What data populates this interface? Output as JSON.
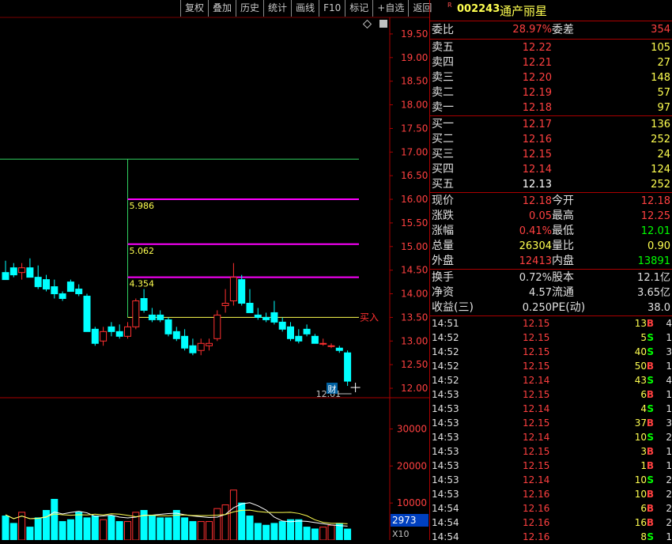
{
  "toolbar": {
    "items": [
      "复权",
      "叠加",
      "历史",
      "统计",
      "画线",
      "F10",
      "标记",
      "+自选",
      "返回"
    ]
  },
  "chart": {
    "price_axis": [
      "19.50",
      "19.00",
      "18.50",
      "18.00",
      "17.50",
      "17.00",
      "16.50",
      "16.00",
      "15.50",
      "15.00",
      "14.50",
      "14.00",
      "13.50",
      "13.00",
      "12.50",
      "12.00"
    ],
    "volume_axis": [
      "30000",
      "20000",
      "10000"
    ],
    "buy_label": "买入",
    "low_label": "12.01",
    "cai_label": "财",
    "fib_labels": [
      "5.986",
      "5.062",
      "4.354"
    ],
    "vol_readout": "2973",
    "vol_unit": "X10",
    "colors": {
      "up": "#ff3030",
      "down": "#00ffff",
      "fib": "#ff00ff",
      "grid": "#7a0000"
    }
  },
  "chart_data": {
    "type": "candlestick",
    "candles": [
      {
        "o": 14.45,
        "h": 14.7,
        "l": 14.3,
        "c": 14.3
      },
      {
        "o": 14.55,
        "h": 14.65,
        "l": 14.35,
        "c": 14.4
      },
      {
        "o": 14.45,
        "h": 14.65,
        "l": 14.3,
        "c": 14.55
      },
      {
        "o": 14.55,
        "h": 14.75,
        "l": 14.35,
        "c": 14.35
      },
      {
        "o": 14.35,
        "h": 14.6,
        "l": 14.1,
        "c": 14.15
      },
      {
        "o": 14.3,
        "h": 14.4,
        "l": 14.05,
        "c": 14.1
      },
      {
        "o": 14.15,
        "h": 14.3,
        "l": 13.9,
        "c": 14.0
      },
      {
        "o": 14.0,
        "h": 14.05,
        "l": 13.85,
        "c": 13.9
      },
      {
        "o": 14.25,
        "h": 14.3,
        "l": 14.05,
        "c": 14.05
      },
      {
        "o": 14.1,
        "h": 14.2,
        "l": 13.95,
        "c": 14.0
      },
      {
        "o": 13.95,
        "h": 14.0,
        "l": 13.2,
        "c": 13.2
      },
      {
        "o": 13.25,
        "h": 13.3,
        "l": 12.9,
        "c": 12.95
      },
      {
        "o": 13.0,
        "h": 13.3,
        "l": 12.9,
        "c": 13.2
      },
      {
        "o": 13.3,
        "h": 13.4,
        "l": 13.1,
        "c": 13.2
      },
      {
        "o": 13.2,
        "h": 13.35,
        "l": 13.05,
        "c": 13.1
      },
      {
        "o": 13.1,
        "h": 13.4,
        "l": 13.05,
        "c": 13.3
      },
      {
        "o": 13.3,
        "h": 13.9,
        "l": 13.25,
        "c": 13.85
      },
      {
        "o": 13.9,
        "h": 14.1,
        "l": 13.6,
        "c": 13.65
      },
      {
        "o": 13.55,
        "h": 13.7,
        "l": 13.4,
        "c": 13.45
      },
      {
        "o": 13.55,
        "h": 13.65,
        "l": 13.4,
        "c": 13.45
      },
      {
        "o": 13.45,
        "h": 13.5,
        "l": 13.1,
        "c": 13.15
      },
      {
        "o": 13.2,
        "h": 13.3,
        "l": 13.0,
        "c": 13.05
      },
      {
        "o": 13.1,
        "h": 13.25,
        "l": 12.8,
        "c": 12.85
      },
      {
        "o": 12.9,
        "h": 13.05,
        "l": 12.7,
        "c": 12.75
      },
      {
        "o": 12.8,
        "h": 13.05,
        "l": 12.7,
        "c": 12.95
      },
      {
        "o": 12.9,
        "h": 13.05,
        "l": 12.8,
        "c": 12.95
      },
      {
        "o": 13.05,
        "h": 13.65,
        "l": 13.0,
        "c": 13.55
      },
      {
        "o": 13.75,
        "h": 14.1,
        "l": 13.6,
        "c": 13.8
      },
      {
        "o": 13.85,
        "h": 14.65,
        "l": 13.75,
        "c": 14.35
      },
      {
        "o": 14.3,
        "h": 14.4,
        "l": 13.75,
        "c": 13.8
      },
      {
        "o": 13.8,
        "h": 14.1,
        "l": 13.6,
        "c": 13.6
      },
      {
        "o": 13.55,
        "h": 13.7,
        "l": 13.45,
        "c": 13.5
      },
      {
        "o": 13.5,
        "h": 13.6,
        "l": 13.4,
        "c": 13.45
      },
      {
        "o": 13.6,
        "h": 13.85,
        "l": 13.35,
        "c": 13.4
      },
      {
        "o": 13.4,
        "h": 13.5,
        "l": 13.2,
        "c": 13.25
      },
      {
        "o": 13.3,
        "h": 13.4,
        "l": 13.0,
        "c": 13.05
      },
      {
        "o": 13.1,
        "h": 13.25,
        "l": 12.95,
        "c": 13.0
      },
      {
        "o": 13.25,
        "h": 13.35,
        "l": 13.1,
        "c": 13.15
      },
      {
        "o": 13.1,
        "h": 13.15,
        "l": 12.95,
        "c": 12.95
      },
      {
        "o": 12.95,
        "h": 13.05,
        "l": 12.9,
        "c": 12.95
      },
      {
        "o": 12.9,
        "h": 12.95,
        "l": 12.85,
        "c": 12.9
      },
      {
        "o": 12.85,
        "h": 12.9,
        "l": 12.75,
        "c": 12.8
      },
      {
        "o": 12.75,
        "h": 12.8,
        "l": 12.05,
        "c": 12.15
      }
    ],
    "volumes": [
      6500,
      4500,
      7500,
      3500,
      6000,
      8000,
      11000,
      5000,
      5500,
      7500,
      6000,
      6500,
      5500,
      6500,
      5000,
      5000,
      7500,
      8000,
      6500,
      6000,
      6000,
      8000,
      6000,
      5000,
      5000,
      5000,
      8500,
      9500,
      13500,
      10000,
      6500,
      4500,
      4000,
      4500,
      5000,
      5500,
      5500,
      3500,
      3000,
      3500,
      4000,
      4500,
      2973
    ],
    "horizontal_levels": {
      "fib_lines": [
        16.0,
        15.05,
        14.35
      ],
      "buy_line": 13.5,
      "top_line": 16.85
    },
    "ylim": [
      11.85,
      19.75
    ],
    "volume_ylim": [
      0,
      38000
    ]
  },
  "quote": {
    "r_mark": "R",
    "code": "002243",
    "name": "通产丽星",
    "weibi_label": "委比",
    "weibi_pct": "28.97%",
    "weicha_label": "委差",
    "weicha_val": "354",
    "asks": [
      {
        "label": "卖五",
        "price": "12.22",
        "vol": "105"
      },
      {
        "label": "卖四",
        "price": "12.21",
        "vol": "27"
      },
      {
        "label": "卖三",
        "price": "12.20",
        "vol": "148"
      },
      {
        "label": "卖二",
        "price": "12.19",
        "vol": "57"
      },
      {
        "label": "卖一",
        "price": "12.18",
        "vol": "97"
      }
    ],
    "bids": [
      {
        "label": "买一",
        "price": "12.17",
        "vol": "136"
      },
      {
        "label": "买二",
        "price": "12.16",
        "vol": "252"
      },
      {
        "label": "买三",
        "price": "12.15",
        "vol": "24"
      },
      {
        "label": "买四",
        "price": "12.14",
        "vol": "124"
      },
      {
        "label": "买五",
        "price": "12.13",
        "vol": "252"
      }
    ],
    "stats": [
      {
        "l1": "现价",
        "v1": "12.18",
        "l2": "今开",
        "v2": "12.18"
      },
      {
        "l1": "涨跌",
        "v1": "0.05",
        "l2": "最高",
        "v2": "12.25"
      },
      {
        "l1": "涨幅",
        "v1": "0.41%",
        "l2": "最低",
        "v2": "12.01"
      },
      {
        "l1": "总量",
        "v1": "26304",
        "l2": "量比",
        "v2": "0.90"
      },
      {
        "l1": "外盘",
        "v1": "12413",
        "l2": "内盘",
        "v2": "13891"
      }
    ],
    "fund": [
      {
        "l1": "换手",
        "v1": "0.72%",
        "l2": "股本",
        "v2": "12.1亿"
      },
      {
        "l1": "净资",
        "v1": "4.57",
        "l2": "流通",
        "v2": "3.65亿"
      },
      {
        "l1": "收益(三)",
        "v1": "0.250",
        "l2": "PE(动)",
        "v2": "38.0"
      }
    ]
  },
  "ticks": [
    {
      "time": "14:51",
      "price": "12.15",
      "qty": "13",
      "side": "B",
      "n": "4"
    },
    {
      "time": "14:52",
      "price": "12.15",
      "qty": "5",
      "side": "S",
      "n": "1"
    },
    {
      "time": "14:52",
      "price": "12.15",
      "qty": "40",
      "side": "S",
      "n": "3"
    },
    {
      "time": "14:52",
      "price": "12.15",
      "qty": "50",
      "side": "B",
      "n": "1"
    },
    {
      "time": "14:52",
      "price": "12.14",
      "qty": "43",
      "side": "S",
      "n": "4"
    },
    {
      "time": "14:53",
      "price": "12.15",
      "qty": "6",
      "side": "B",
      "n": "1"
    },
    {
      "time": "14:53",
      "price": "12.14",
      "qty": "4",
      "side": "S",
      "n": "1"
    },
    {
      "time": "14:53",
      "price": "12.15",
      "qty": "37",
      "side": "B",
      "n": "3"
    },
    {
      "time": "14:53",
      "price": "12.14",
      "qty": "10",
      "side": "S",
      "n": "2"
    },
    {
      "time": "14:53",
      "price": "12.15",
      "qty": "3",
      "side": "B",
      "n": "1"
    },
    {
      "time": "14:53",
      "price": "12.15",
      "qty": "1",
      "side": "B",
      "n": "1"
    },
    {
      "time": "14:53",
      "price": "12.14",
      "qty": "10",
      "side": "S",
      "n": "2"
    },
    {
      "time": "14:53",
      "price": "12.16",
      "qty": "10",
      "side": "B",
      "n": "2"
    },
    {
      "time": "14:54",
      "price": "12.16",
      "qty": "6",
      "side": "B",
      "n": "2"
    },
    {
      "time": "14:54",
      "price": "12.16",
      "qty": "16",
      "side": "B",
      "n": "2"
    },
    {
      "time": "14:54",
      "price": "12.16",
      "qty": "8",
      "side": "S",
      "n": "1"
    }
  ]
}
